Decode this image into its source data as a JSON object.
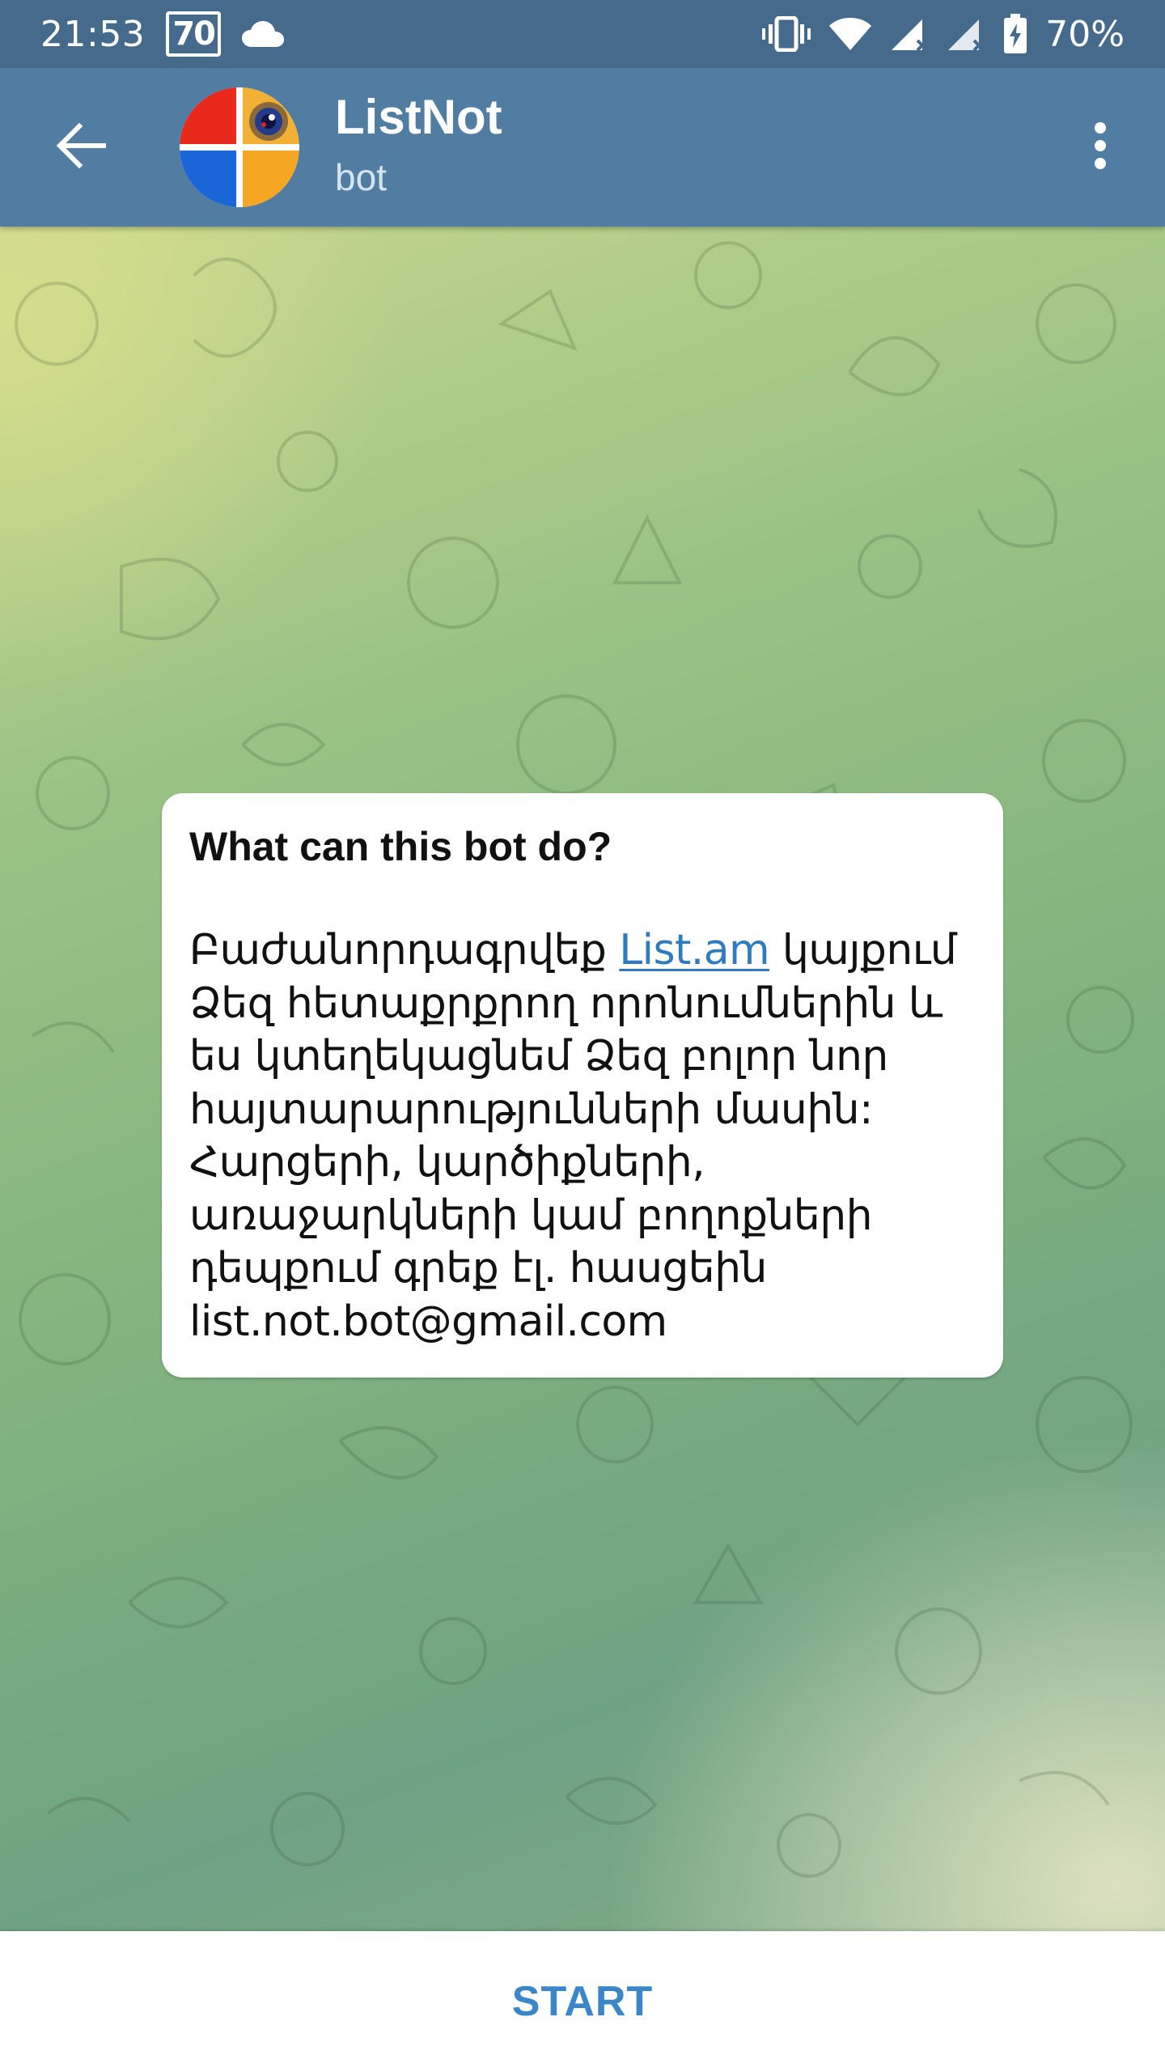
{
  "status_bar": {
    "time": "21:53",
    "badge": "70",
    "battery_percent": "70%",
    "icons": [
      "cloud-icon",
      "vibrate-icon",
      "wifi-icon",
      "signal-icon",
      "signal-icon-2",
      "battery-charging-icon"
    ]
  },
  "header": {
    "title": "ListNot",
    "subtitle": "bot",
    "back_icon": "arrow-left-icon",
    "menu_icon": "more-vertical-icon"
  },
  "info_card": {
    "title": "What can this bot do?",
    "line1_before": "Բաժանորդագրվեք ",
    "line1_link": "List.am",
    "line1_after": " կայքում",
    "line2": "Ձեզ հետաքրքրող որոնումներին և",
    "line3": "ես կտեղեկացնեմ Ձեզ բոլոր նոր",
    "line4": "հայտարարությունների մասին:",
    "line5": "Հարցերի, կարծիքների,",
    "line6": "առաջարկների կամ բողոքների",
    "line7": "դեպքում գրեք էլ. հասցեին",
    "line8": "list.not.bot@gmail.com"
  },
  "bottom_bar": {
    "start_label": "START"
  },
  "colors": {
    "status_bar": "#456a8c",
    "app_bar": "#517da2",
    "link": "#2f7bbf",
    "start_button": "#3a86c9"
  }
}
